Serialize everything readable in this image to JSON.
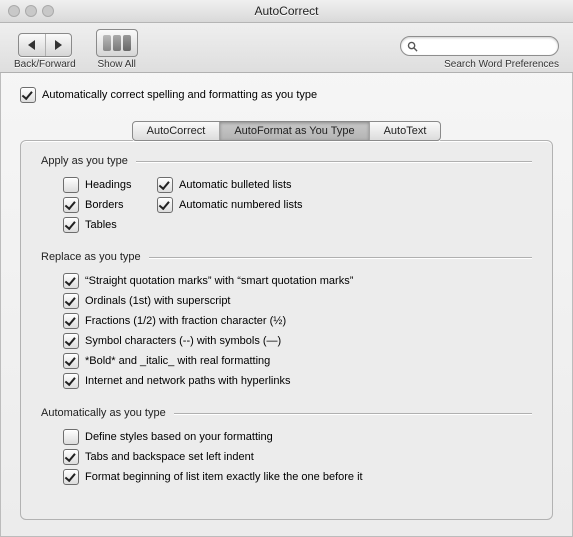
{
  "window": {
    "title": "AutoCorrect"
  },
  "toolbar": {
    "backForwardLabel": "Back/Forward",
    "showAllLabel": "Show All",
    "searchCaption": "Search Word Preferences",
    "searchPlaceholder": ""
  },
  "masterToggle": {
    "label": "Automatically correct spelling and formatting as you type",
    "checked": true
  },
  "tabs": [
    {
      "id": "autocorrect",
      "label": "AutoCorrect",
      "selected": false
    },
    {
      "id": "autoformat",
      "label": "AutoFormat as You Type",
      "selected": true
    },
    {
      "id": "autotext",
      "label": "AutoText",
      "selected": false
    }
  ],
  "sections": {
    "apply": {
      "title": "Apply as you type",
      "left": [
        {
          "id": "headings",
          "label": "Headings",
          "checked": false
        },
        {
          "id": "borders",
          "label": "Borders",
          "checked": true
        },
        {
          "id": "tables",
          "label": "Tables",
          "checked": true
        }
      ],
      "right": [
        {
          "id": "bulleted",
          "label": "Automatic bulleted lists",
          "checked": true
        },
        {
          "id": "numbered",
          "label": "Automatic numbered lists",
          "checked": true
        }
      ]
    },
    "replace": {
      "title": "Replace as you type",
      "items": [
        {
          "id": "quotes",
          "label": "“Straight quotation marks” with “smart quotation marks”",
          "checked": true
        },
        {
          "id": "ordinals",
          "label": "Ordinals (1st) with superscript",
          "checked": true
        },
        {
          "id": "fractions",
          "label": "Fractions (1/2) with fraction character (½)",
          "checked": true
        },
        {
          "id": "symbols",
          "label": "Symbol characters (--) with symbols (—)",
          "checked": true
        },
        {
          "id": "bolditalic",
          "label": "*Bold* and _italic_ with real formatting",
          "checked": true
        },
        {
          "id": "hyperlinks",
          "label": "Internet and network paths with hyperlinks",
          "checked": true
        }
      ]
    },
    "auto": {
      "title": "Automatically as you type",
      "items": [
        {
          "id": "definestyles",
          "label": "Define styles based on your formatting",
          "checked": false
        },
        {
          "id": "tabsindent",
          "label": "Tabs and backspace set left indent",
          "checked": true
        },
        {
          "id": "formatlist",
          "label": "Format beginning of list item exactly like the one before it",
          "checked": true
        }
      ]
    }
  }
}
